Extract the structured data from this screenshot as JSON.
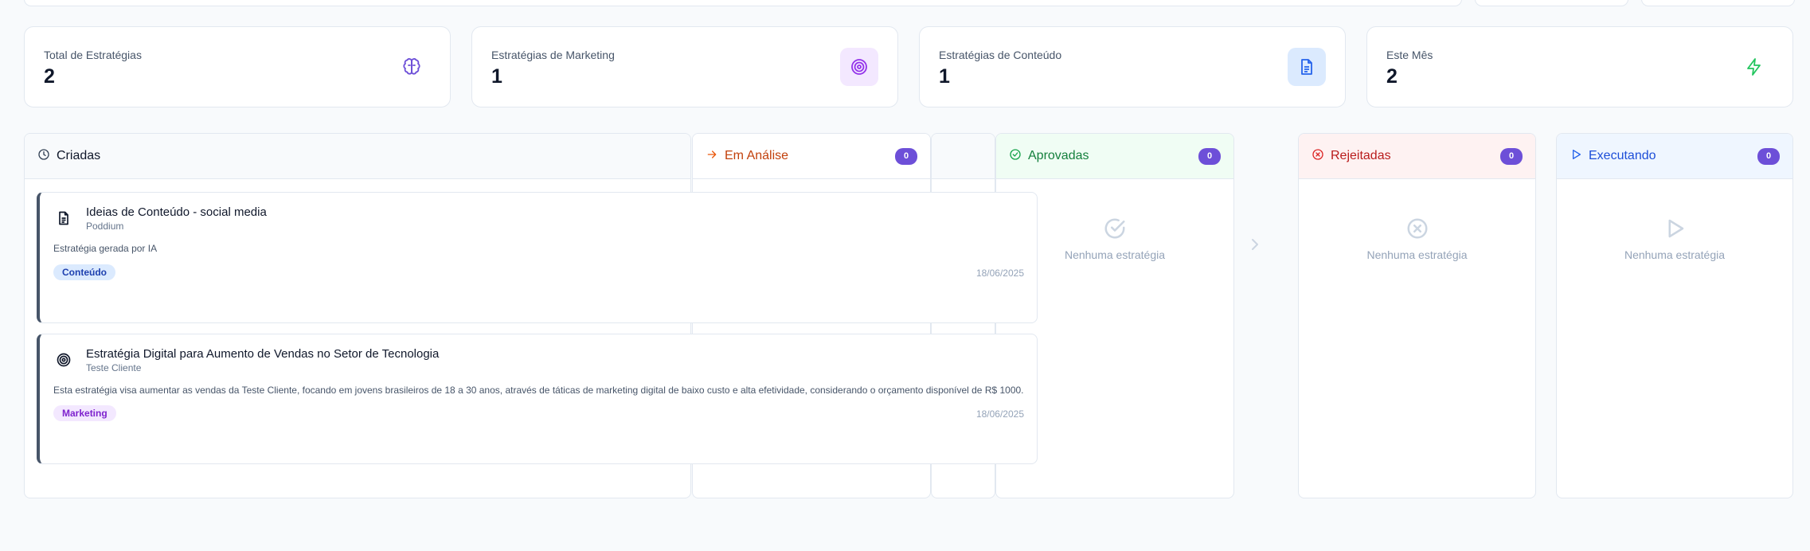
{
  "stats": [
    {
      "label": "Total de Estratégias",
      "value": "2",
      "icon": "brain-icon"
    },
    {
      "label": "Estratégias de Marketing",
      "value": "1",
      "icon": "target-icon"
    },
    {
      "label": "Estratégias de Conteúdo",
      "value": "1",
      "icon": "document-icon"
    },
    {
      "label": "Este Mês",
      "value": "2",
      "icon": "zap-icon"
    }
  ],
  "columns": {
    "criadas": {
      "title": "Criadas"
    },
    "em_analise": {
      "title": "Em Análise",
      "count": "0"
    },
    "aprovadas": {
      "title": "Aprovadas",
      "count": "0",
      "empty": "Nenhuma estratégia"
    },
    "rejeitadas": {
      "title": "Rejeitadas",
      "count": "0",
      "empty": "Nenhuma estratégia"
    },
    "executando": {
      "title": "Executando",
      "count": "0",
      "empty": "Nenhuma estratégia"
    }
  },
  "cards": [
    {
      "title": "Ideias de Conteúdo - social media",
      "client": "Poddium",
      "description": "Estratégia gerada por IA",
      "tag": "Conteúdo",
      "date": "18/06/2025",
      "icon": "document-icon"
    },
    {
      "title": "Estratégia Digital para Aumento de Vendas no Setor de Tecnologia",
      "client": "Teste Cliente",
      "description": "Esta estratégia visa aumentar as vendas da Teste Cliente, focando em jovens brasileiros de 18 a 30 anos, através de táticas de marketing digital de baixo custo e alta efetividade, considerando o orçamento disponível de R$ 1000.",
      "tag": "Marketing",
      "date": "18/06/2025",
      "icon": "target-icon"
    }
  ],
  "colors": {
    "accent": "#6d4fd8",
    "em_analise": "#c2410c",
    "aprovadas": "#15803d",
    "rejeitadas": "#b91c1c",
    "executando": "#1d4ed8",
    "tag_conteudo_bg": "#dbeafe",
    "tag_marketing_bg": "#f3e8ff"
  }
}
